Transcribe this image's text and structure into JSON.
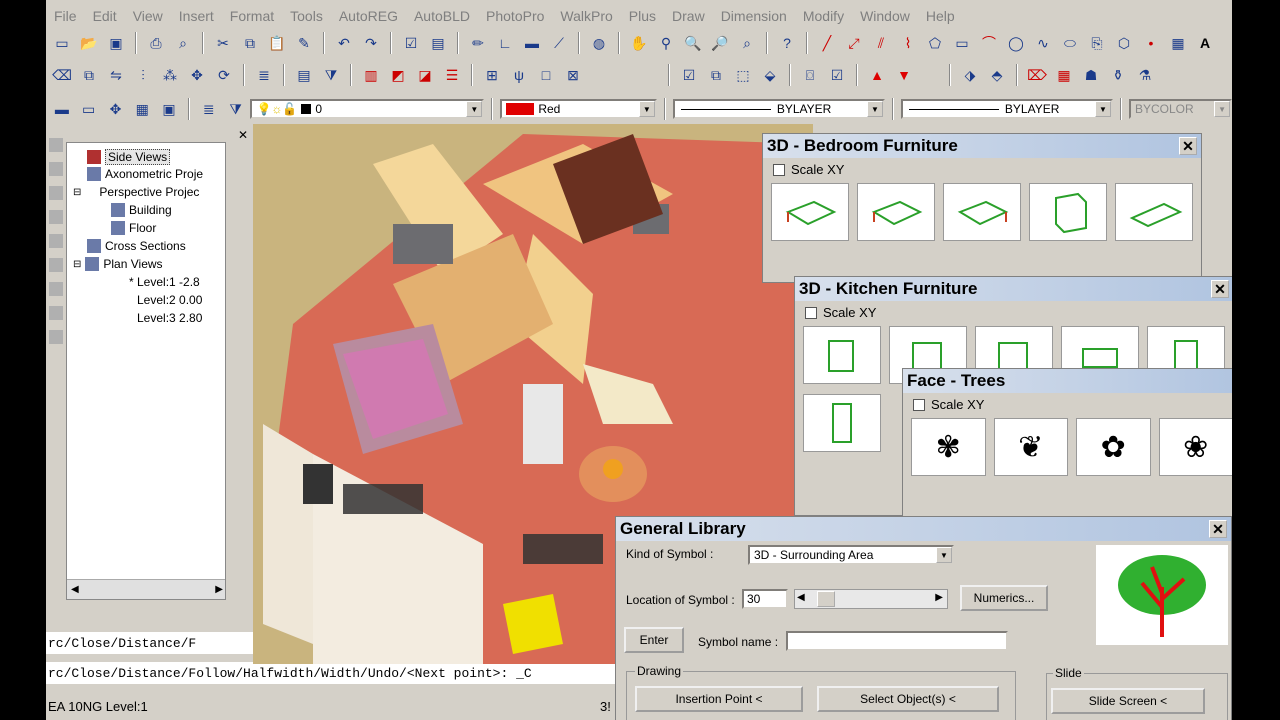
{
  "menu": [
    "File",
    "Edit",
    "View",
    "Insert",
    "Format",
    "Tools",
    "AutoREG",
    "AutoBLD",
    "PhotoPro",
    "WalkPro",
    "Plus",
    "Draw",
    "Dimension",
    "Modify",
    "Window",
    "Help"
  ],
  "layer_value": "0",
  "color_value": "Red",
  "linetype_value": "BYLAYER",
  "lineweight_value": "BYLAYER",
  "plotstyle_value": "BYCOLOR",
  "tree": {
    "items": [
      {
        "label": "Side Views"
      },
      {
        "label": "Axonometric Proje"
      },
      {
        "label": "Perspective Projec"
      },
      {
        "label": "Building"
      },
      {
        "label": "Floor"
      },
      {
        "label": "Cross Sections"
      },
      {
        "label": "Plan Views"
      },
      {
        "label": "* Level:1  -2.8"
      },
      {
        "label": "Level:2  0.00"
      },
      {
        "label": "Level:3  2.80"
      }
    ]
  },
  "command": {
    "line1": "rc/Close/Distance/F",
    "line2": "rc/Close/Distance/Follow/Halfwidth/Width/Undo/<Next point>: _C"
  },
  "status": {
    "text": "EA 10NG Level:1",
    "right": "3!"
  },
  "bedroom": {
    "title": "3D - Bedroom Furniture",
    "scale": "Scale XY"
  },
  "kitchen": {
    "title": "3D - Kitchen Furniture",
    "scale": "Scale XY"
  },
  "trees": {
    "title": "Face - Trees",
    "scale": "Scale XY"
  },
  "library": {
    "title": "General Library",
    "kind_label": "Kind of Symbol :",
    "kind_value": "3D - Surrounding Area",
    "location_label": "Location of Symbol :",
    "location_value": "30",
    "numerics": "Numerics...",
    "enter": "Enter",
    "symbol_label": "Symbol name :",
    "symbol_value": "",
    "drawing_group": "Drawing",
    "slide_group": "Slide",
    "insertion": "Insertion Point <",
    "select": "Select Object(s) <",
    "slide_screen": "Slide Screen <"
  },
  "colors": {
    "accent_red": "#e00000",
    "panel": "#d4d0c8",
    "furniture_green": "#2aa02a"
  }
}
